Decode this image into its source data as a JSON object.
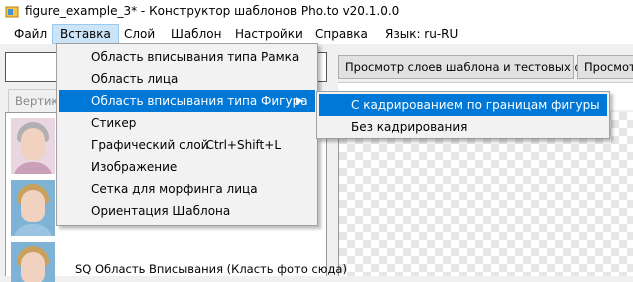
{
  "window": {
    "title": "figure_example_3* - Конструктор шаблонов Pho.to v20.1.0.0"
  },
  "menubar": {
    "items": [
      "Файл",
      "Вставка",
      "Слой",
      "Шаблон",
      "Настройки",
      "Справка",
      "Язык: ru-RU"
    ],
    "active": "Вставка"
  },
  "toolbar": {
    "preview_layers_label": "Просмотр слоев шаблона и тестовых фото",
    "preview2_label": "Просмотр",
    "vertical_label": "Вертикаль"
  },
  "insert_menu": {
    "items": [
      {
        "label": "Область вписывания типа Рамка",
        "shortcut": ""
      },
      {
        "label": "Область лица",
        "shortcut": ""
      },
      {
        "label": "Область вписывания типа Фигура",
        "shortcut": "",
        "submenu": true,
        "highlighted": true
      },
      {
        "label": "Стикер",
        "shortcut": ""
      },
      {
        "label": "Графический слой",
        "shortcut": "Ctrl+Shift+L"
      },
      {
        "label": "Изображение",
        "shortcut": ""
      },
      {
        "label": "Сетка для морфинга лица",
        "shortcut": ""
      },
      {
        "label": "Ориентация Шаблона",
        "shortcut": ""
      }
    ]
  },
  "shape_submenu": {
    "items": [
      {
        "label": "С кадрированием по границам фигуры",
        "highlighted": true
      },
      {
        "label": "Без кадрирования",
        "highlighted": false
      }
    ]
  },
  "layer_list": {
    "visible_row_label": "SQ Область Вписывания (Класть фото сюда)"
  },
  "colors": {
    "highlight": "#0078d7",
    "menu_active": "#cce4f7"
  }
}
